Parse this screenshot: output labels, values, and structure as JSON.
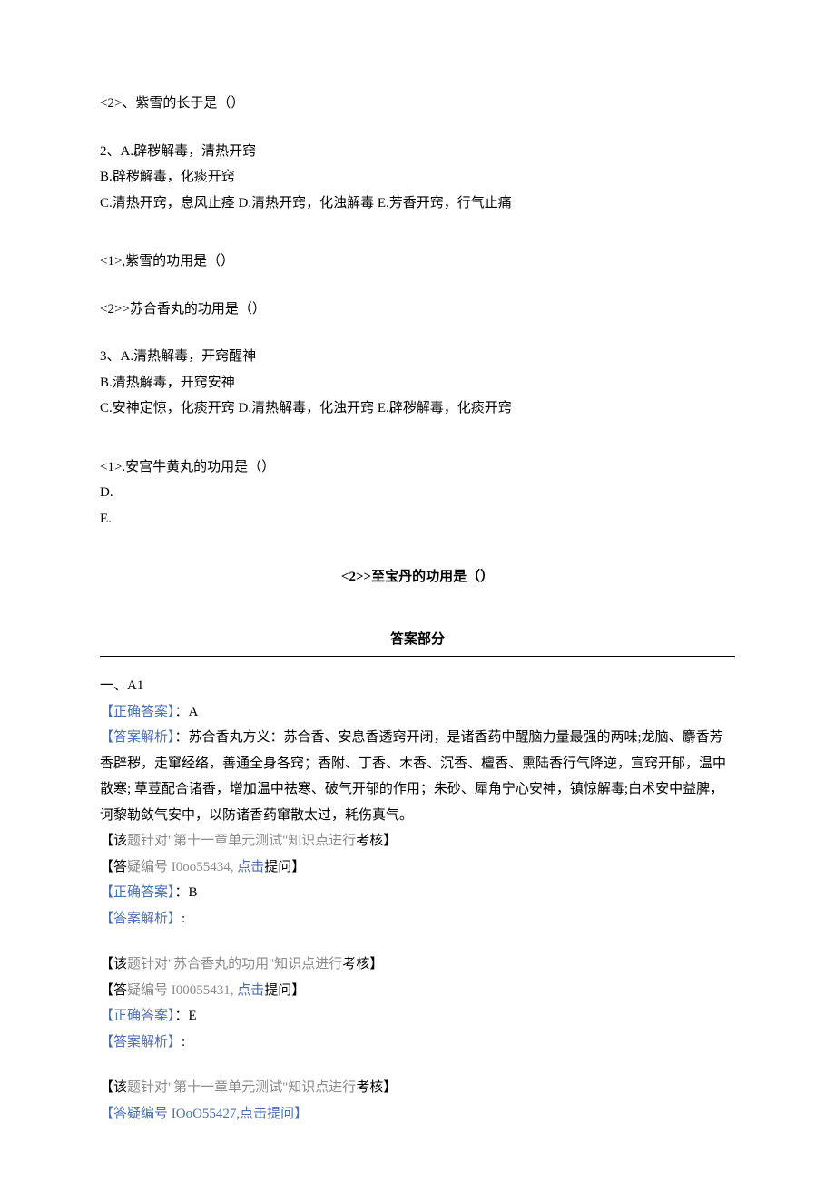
{
  "q2_1": "<2>、紫雪的长于是（）",
  "q2_opts": {
    "a": "2、A.辟秽解毒，清热开窍",
    "b": "B.辟秽解毒，化痰开窍",
    "c": "C.清热开窍，息风止痉 D.清热开窍，化浊解毒 E.芳香开窍，行气止痛"
  },
  "q2_sub1": "<1>,紫雪的功用是（）",
  "q2_sub2": "<2>>苏合香丸的功用是（）",
  "q3_opts": {
    "a": "3、A.清热解毒，开窍醒神",
    "b": "B.清热解毒，开窍安神",
    "c": "C.安神定惊，化痰开窍 D.清热解毒，化浊开窍 E.辟秽解毒，化痰开窍"
  },
  "q3_sub1": "<1>.安宫牛黄丸的功用是（）",
  "q3_d": "D.",
  "q3_e": "E.",
  "q3_sub2": "<2>>至宝丹的功用是（）",
  "ans_section": "答案部分",
  "a1_head": "一、A1",
  "a1": {
    "correct_label": "【正确答案】",
    "correct_val": "：A",
    "analysis_label": "【答案解析】",
    "analysis_text": "：苏合香丸方义：苏合香、安息香透窍开闭，是诸香药中醒脑力量最强的两味;龙脑、麝香芳香辟秽，走窜经络，善通全身各窍；香附、丁香、木香、沉香、檀香、熏陆香行气降逆，宣窍开郁，温中散寒; 草荳配合诸香，增加温中祛寒、破气开郁的作用；朱砂、犀角宁心安神，镇惊解毒;白术安中益脾，诃黎勒敛气安中，以防诸香药窜散太过，耗伤真气。",
    "target_prefix": "【该",
    "target_mid1": "题针对\"第十一章单元测试\"知识点进行",
    "target_suffix": "考核】",
    "doubt_open": "【答",
    "doubt_label": "疑编号 I0oo55434, ",
    "doubt_click": "点击",
    "doubt_close": "提问】"
  },
  "a2": {
    "correct_label": "【正确答案】",
    "correct_val": "：B",
    "analysis_label": "【答案解析】",
    "analysis_colon": ":",
    "target_prefix": "【该",
    "target_mid1": "题针对\"苏合香丸的功用\"知识点进行",
    "target_suffix": "考核】",
    "doubt_open": "【答",
    "doubt_label": "疑编号 I00055431, ",
    "doubt_click": "点击",
    "doubt_close": "提问】"
  },
  "a3": {
    "correct_label": "【正确答案】",
    "correct_val": "：E",
    "analysis_label": "【答案解析】",
    "analysis_colon": ":",
    "target_prefix": "【该",
    "target_mid1": "题针对\"第十一章单元测试\"知识点进行",
    "target_suffix": "考核】",
    "doubt_full": "【答疑编号 IOoO55427,点击提问】"
  }
}
